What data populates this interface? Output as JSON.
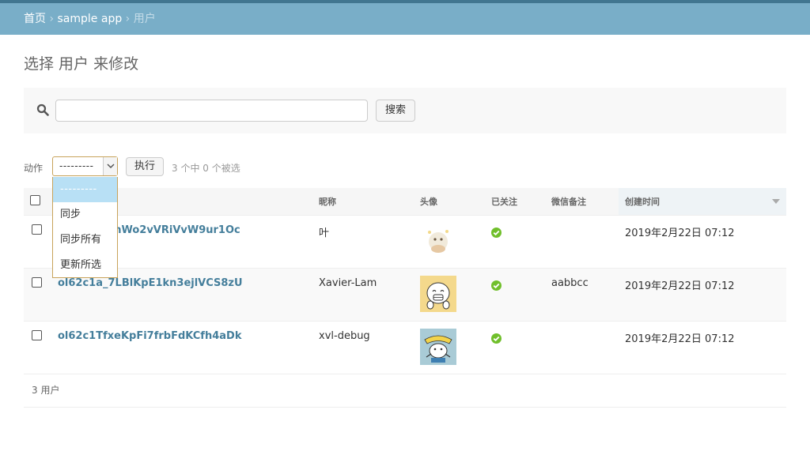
{
  "breadcrumbs": {
    "home": "首页",
    "app": "sample app",
    "current": "用户",
    "separator": "›"
  },
  "page_title": "选择 用户 来修改",
  "search": {
    "placeholder": "",
    "value": "",
    "button_label": "搜索"
  },
  "actions": {
    "label": "动作",
    "selected": "---------",
    "go_label": "执行",
    "counter": "3 个中 0 个被选",
    "options": [
      "---------",
      "同步",
      "同步所有",
      "更新所选"
    ]
  },
  "table": {
    "headers": {
      "openid": "",
      "nickname": "昵称",
      "avatar": "头像",
      "subscribed": "已关注",
      "remark": "微信备注",
      "created": "创建时间"
    },
    "rows": [
      {
        "openid": "ol62c1a_chWo2vVRiVvW9ur1Oc",
        "nickname": "叶",
        "remark": "",
        "created": "2019年2月22日 07:12",
        "subscribed": "yes"
      },
      {
        "openid": "ol62c1a_7LBlKpE1kn3ejlVCS8zU",
        "nickname": "Xavier-Lam",
        "remark": "aabbcc",
        "created": "2019年2月22日 07:12",
        "subscribed": "yes"
      },
      {
        "openid": "ol62c1TfxeKpFi7frbFdKCfh4aDk",
        "nickname": "xvl-debug",
        "remark": "",
        "created": "2019年2月22日 07:12",
        "subscribed": "yes"
      }
    ]
  },
  "paginator": "3 用户",
  "colors": {
    "header_bar": "#79aec8",
    "link": "#447e9b",
    "ok_green": "#70bf2b",
    "select_border": "#c8a35a",
    "dropdown_selected": "#b8e0f5"
  }
}
